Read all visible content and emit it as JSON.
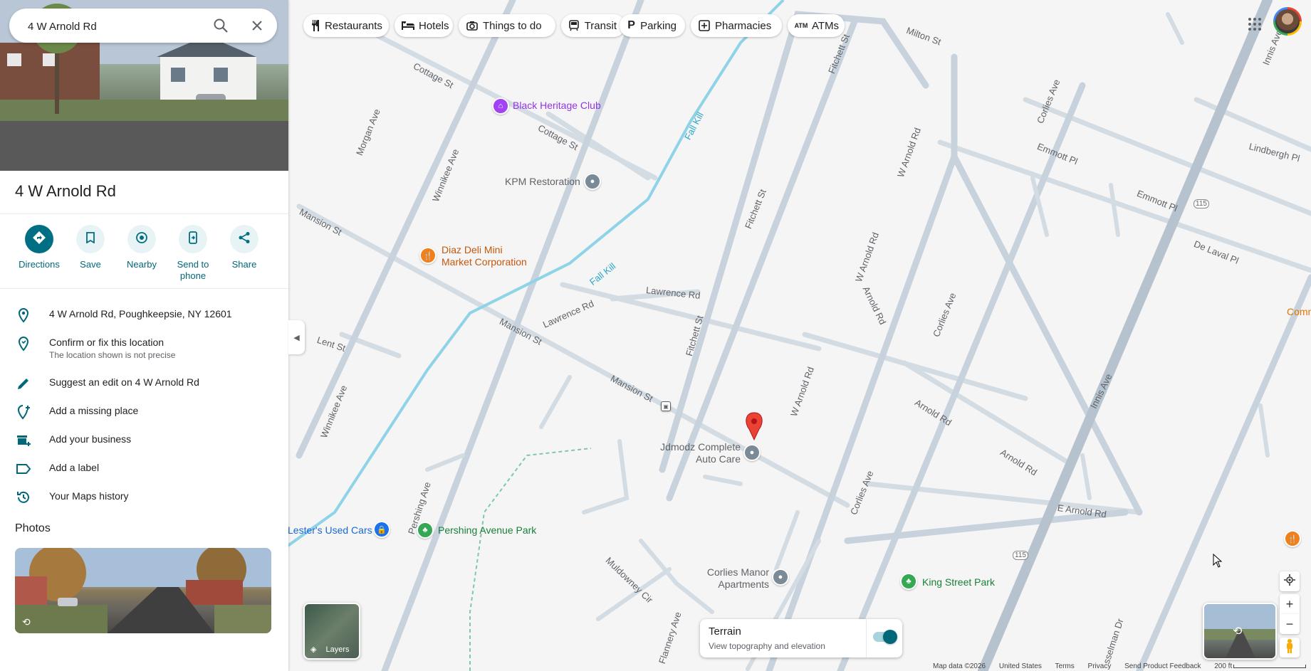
{
  "search": {
    "value": "4 W Arnold Rd",
    "search_icon": "search-icon",
    "close_icon": "close-icon"
  },
  "place": {
    "title": "4 W Arnold Rd",
    "actions": [
      {
        "label": "Directions",
        "icon": "directions-icon"
      },
      {
        "label": "Save",
        "icon": "bookmark-icon"
      },
      {
        "label": "Nearby",
        "icon": "nearby-icon"
      },
      {
        "label": "Send to phone",
        "icon": "send-to-phone-icon"
      },
      {
        "label": "Share",
        "icon": "share-icon"
      }
    ],
    "rows": [
      {
        "text": "4 W Arnold Rd, Poughkeepsie, NY 12601",
        "icon": "location-pin-icon"
      },
      {
        "text": "Confirm or fix this location",
        "sub": "The location shown is not precise",
        "icon": "location-pin-outline-icon"
      },
      {
        "text": "Suggest an edit on 4 W Arnold Rd",
        "icon": "pencil-icon"
      },
      {
        "text": "Add a missing place",
        "icon": "add-place-icon"
      },
      {
        "text": "Add your business",
        "icon": "add-business-icon"
      },
      {
        "text": "Add a label",
        "icon": "label-icon"
      },
      {
        "text": "Your Maps history",
        "icon": "history-icon"
      }
    ],
    "photos_heading": "Photos"
  },
  "chips": [
    {
      "label": "Restaurants",
      "icon": "fork-knife-icon"
    },
    {
      "label": "Hotels",
      "icon": "bed-icon"
    },
    {
      "label": "Things to do",
      "icon": "camera-icon"
    },
    {
      "label": "Transit",
      "icon": "train-icon"
    },
    {
      "label": "Parking",
      "icon": "parking-icon"
    },
    {
      "label": "Pharmacies",
      "icon": "pharmacy-icon"
    },
    {
      "label": "ATMs",
      "icon": "atm-icon"
    }
  ],
  "map": {
    "streets": {
      "milton": "Milton St",
      "cottage1": "Cottage St",
      "cottage2": "Cottage St",
      "morgan": "Morgan Ave",
      "winnikee1": "Winnikee Ave",
      "winnikee2": "Winnikee Ave",
      "fallkill1": "Fall Kill",
      "fallkill2": "Fall Kill",
      "mansion1": "Mansion St",
      "mansion2": "Mansion St",
      "mansion3": "Mansion St",
      "lent": "Lent St",
      "lawrence1": "Lawrence Rd",
      "lawrence2": "Lawrence Rd",
      "fitchett1": "Fitchett St",
      "fitchett2": "Fitchett St",
      "fitchett3": "Fitchett St",
      "warnold1": "W Arnold Rd",
      "warnold2": "W Arnold Rd",
      "warnold3": "W Arnold Rd",
      "arnold1": "Arnold Rd",
      "arnold2": "Arnold Rd",
      "arnold3": "Arnold Rd",
      "earnold": "E Arnold Rd",
      "corlies1": "Corlies Ave",
      "corlies2": "Corlies Ave",
      "corlies3": "Corlies Ave",
      "emmott1": "Emmott Pl",
      "emmott2": "Emmott Pl",
      "delaval": "De Laval Pl",
      "lindbergh": "Lindbergh Pl",
      "innis1": "Innis Ave",
      "innis2": "Innis Ave",
      "pershing": "Pershing Ave",
      "muldowney": "Muldowney Cir",
      "flannery": "Flannery Ave",
      "sselman": "sselman Dr",
      "route1": "115",
      "route2": "115",
      "comm": "Comm"
    },
    "pois": {
      "black_heritage": "Black Heritage Club",
      "kpm": "KPM Restoration",
      "diaz": "Diaz Deli Mini\nMarket Corporation",
      "jdmodz": "Jdmodz Complete\nAuto Care",
      "lesters": "Lester's Used Cars",
      "pershing_park": "Pershing Avenue Park",
      "corlies_manor": "Corlies Manor\nApartments",
      "king_park": "King Street Park"
    }
  },
  "layers_label": "Layers",
  "terrain": {
    "title": "Terrain",
    "subtitle": "View topography and elevation",
    "enabled": true
  },
  "footer": {
    "map_data": "Map data ©2026",
    "country": "United States",
    "terms": "Terms",
    "privacy": "Privacy",
    "feedback": "Send Product Feedback",
    "scale": "200 ft"
  },
  "colors": {
    "accent": "#00687a",
    "water": "#8fd3e8",
    "road": "#c4ced8",
    "pin": "#ea4335"
  }
}
